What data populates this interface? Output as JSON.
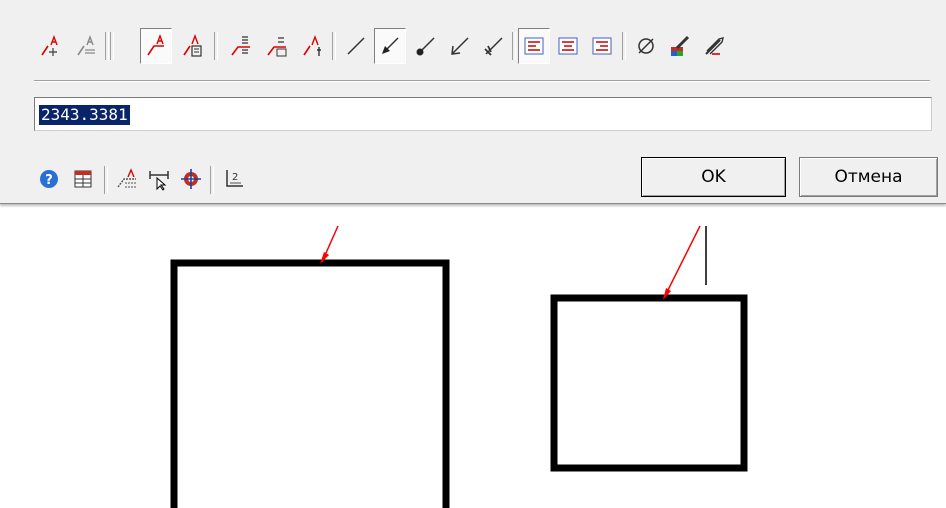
{
  "dialog": {
    "text_value": "2343.3381",
    "ok_label": "OK",
    "cancel_label": "Отмена"
  },
  "icons_top": [
    "add-text-icon",
    "text-style-icon",
    "leader-text-icon",
    "leader-text-box-icon",
    "text-above-icon",
    "text-box-above-icon",
    "text-right-icon",
    "line-plain-icon",
    "arrow-icon",
    "dot-end-icon",
    "open-arrow-icon",
    "slash-arrow-icon",
    "align-left-icon",
    "align-center-icon",
    "align-right-icon",
    "diameter-icon",
    "color-brush-icon",
    "pen-style-icon"
  ],
  "icons_bottom": [
    "help-icon",
    "table-icon",
    "underline-text-icon",
    "dimension-pick-icon",
    "target-icon",
    "list-number-icon"
  ],
  "colors": {
    "dialog_bg": "#f0f0f0",
    "selection_bg": "#0a246a",
    "leader_red": "#ff0000",
    "outline_black": "#000000"
  }
}
